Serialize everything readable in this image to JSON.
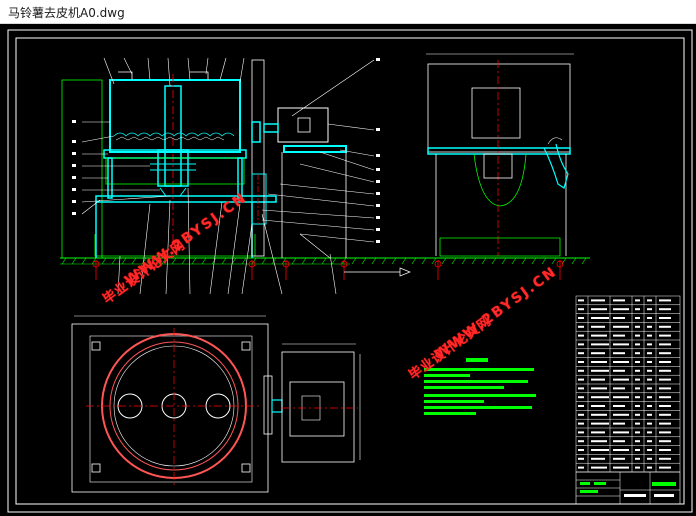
{
  "window": {
    "title": "马铃薯去皮机A0.dwg"
  },
  "watermark": {
    "line1": "毕业设计论文网",
    "line2": "WWW.2BYSJ.CN"
  },
  "colors": {
    "background": "#000000",
    "frame": "#ffffff",
    "part": "#00ffff",
    "outline": "#00ff00",
    "center_line": "#ff0000",
    "leader": "#ffffff",
    "hatch": "#00ff00",
    "watermark": "#ff2a2a",
    "notes": "#00ff00"
  },
  "drawing": {
    "views": [
      "front-view",
      "side-view",
      "top-view"
    ],
    "technical_notes_lines": 9,
    "parts_list_rows": 20
  }
}
